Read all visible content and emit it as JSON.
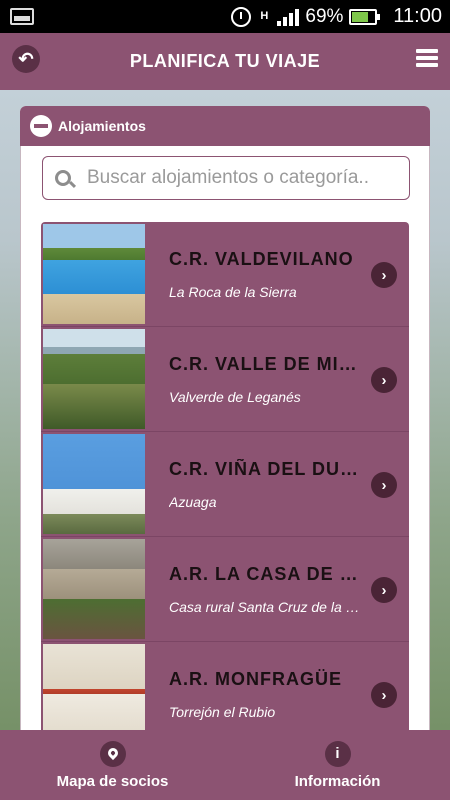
{
  "status_bar": {
    "network": "H",
    "battery": "69%",
    "time": "11:00"
  },
  "header": {
    "title": "PLANIFICA TU VIAJE",
    "back_icon": "back-arrow-icon",
    "menu_icon": "hamburger-menu-icon"
  },
  "section": {
    "title": "Alojamientos",
    "toggle_icon": "minus-icon"
  },
  "search": {
    "placeholder": "Buscar alojamientos o categoría.."
  },
  "accommodations": [
    {
      "name": "C.R. VALDEVILANO",
      "location": "La Roca de la Sierra"
    },
    {
      "name": "C.R. VALLE DE MIRA",
      "location": "Valverde de Leganés"
    },
    {
      "name": "C.R. VIÑA DEL DUCO",
      "location": "Azuaga"
    },
    {
      "name": "A.R. LA CASA DE LA",
      "location": "Casa rural Santa Cruz de la Sierra"
    },
    {
      "name": "A.R. MONFRAGÜE",
      "location": "Torrejón el Rubio"
    }
  ],
  "bottom_nav": {
    "map_label": "Mapa de socios",
    "info_label": "Información"
  },
  "colors": {
    "primary": "#8c5372",
    "dark_accent": "#5a3046"
  }
}
